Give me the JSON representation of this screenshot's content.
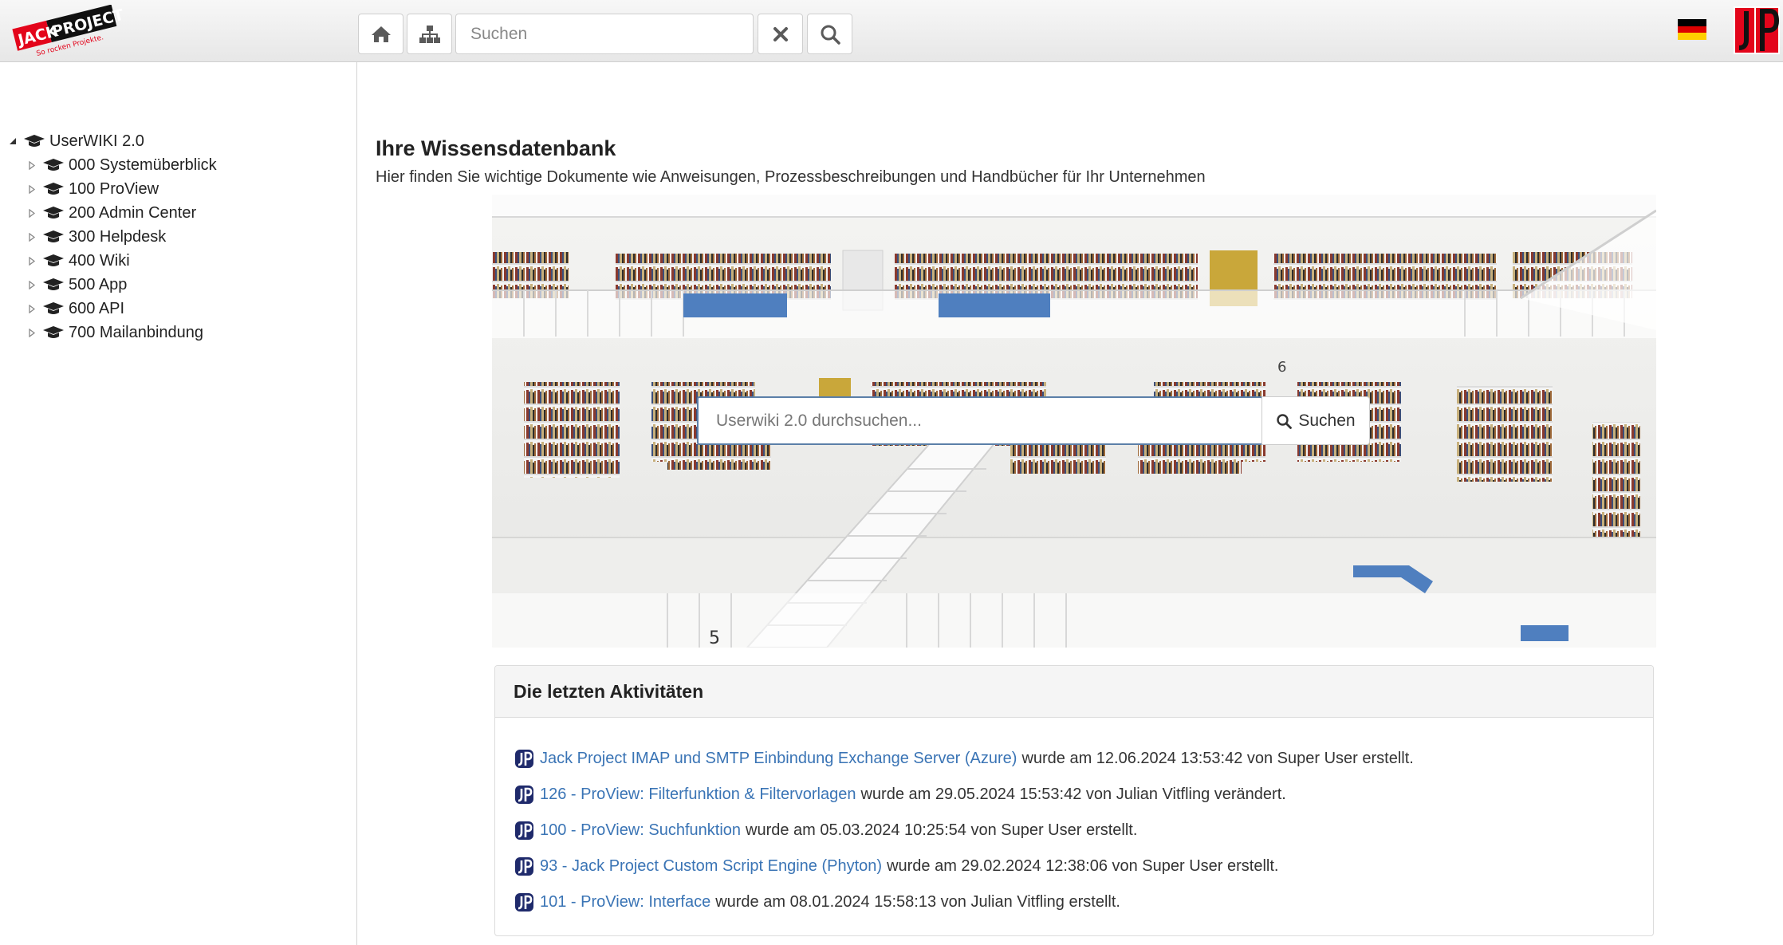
{
  "header": {
    "logo_alt": "Jack Project - So rocken Projekte.",
    "logo_text": "JACKPROJECT",
    "logo_tagline": "So rocken Projekte.",
    "home_icon": "home-icon",
    "sitemap_icon": "sitemap-icon",
    "search_placeholder": "Suchen",
    "clear_icon": "close-icon",
    "search_icon": "search-icon",
    "language_flag": "de-flag-icon",
    "brand_mark": "JP",
    "colors": {
      "brand_red": "#e3051b",
      "link_blue": "#3a74b5"
    }
  },
  "sidebar": {
    "root": {
      "label": "UserWIKI 2.0",
      "expanded": true
    },
    "items": [
      {
        "label": "000 Systemüberblick"
      },
      {
        "label": "100 ProView"
      },
      {
        "label": "200 Admin Center"
      },
      {
        "label": "300 Helpdesk"
      },
      {
        "label": "400 Wiki"
      },
      {
        "label": "500 App"
      },
      {
        "label": "600 API"
      },
      {
        "label": "700 Mailanbindung"
      }
    ]
  },
  "main": {
    "title": "Ihre Wissensdatenbank",
    "subtitle": "Hier finden Sie wichtige Dokumente wie Anweisungen, Prozessbeschreibungen und Handbücher für Ihr Unternehmen",
    "hero_search": {
      "placeholder": "Userwiki 2.0 durchsuchen...",
      "button_label": "Suchen"
    },
    "activities": {
      "heading": "Die letzten Aktivitäten",
      "items": [
        {
          "link": "Jack Project IMAP und SMTP Einbindung Exchange Server (Azure)",
          "text": "wurde am 12.06.2024 13:53:42 von Super User erstellt."
        },
        {
          "link": "126 - ProView: Filterfunktion & Filtervorlagen",
          "text": "wurde am 29.05.2024 15:53:42 von Julian Vitfling verändert."
        },
        {
          "link": "100 - ProView: Suchfunktion",
          "text": "wurde am 05.03.2024 10:25:54 von Super User erstellt."
        },
        {
          "link": "93 - Jack Project Custom Script Engine (Phyton)",
          "text": "wurde am 29.02.2024 12:38:06 von Super User erstellt."
        },
        {
          "link": "101 - ProView: Interface",
          "text": "wurde am 08.01.2024 15:58:13 von Julian Vitfling erstellt."
        }
      ]
    }
  }
}
